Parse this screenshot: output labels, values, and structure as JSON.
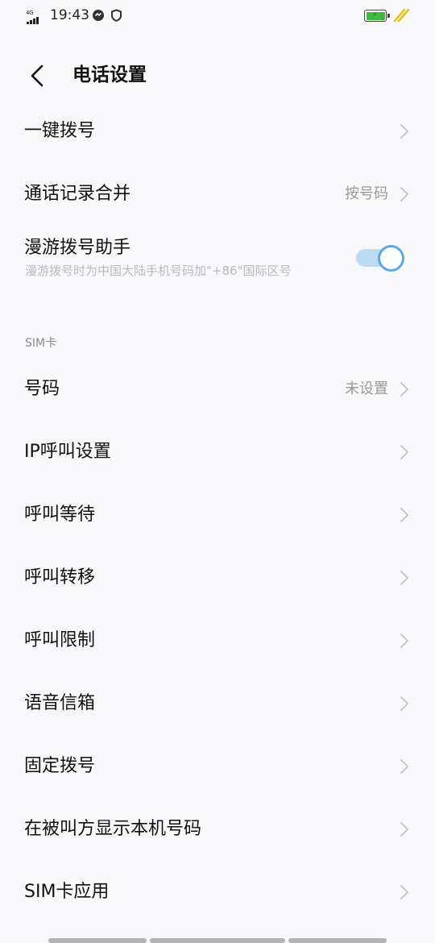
{
  "status_bar": {
    "network": "4G",
    "time": "19:43",
    "icons": [
      "signal-icon",
      "notification-app-icon",
      "shield-icon",
      "battery-icon",
      "charging-icon"
    ],
    "battery_color": "#3dbb3f"
  },
  "header": {
    "back_icon": "chevron-left-icon",
    "title": "电话设置"
  },
  "settings": {
    "one_touch_dial": {
      "label": "一键拨号"
    },
    "merge_call_log": {
      "label": "通话记录合并",
      "value": "按号码"
    },
    "roaming_assistant": {
      "label": "漫游拨号助手",
      "description": "漫游拨号时为中国大陆手机号码加\"+86\"国际区号",
      "enabled": true
    }
  },
  "sim_section": {
    "title": "SIM卡",
    "number": {
      "label": "号码",
      "value": "未设置"
    },
    "ip_call": {
      "label": "IP呼叫设置"
    },
    "call_waiting": {
      "label": "呼叫等待"
    },
    "call_forwarding": {
      "label": "呼叫转移"
    },
    "call_barring": {
      "label": "呼叫限制"
    },
    "voicemail": {
      "label": "语音信箱"
    },
    "fixed_dialing": {
      "label": "固定拨号"
    },
    "show_my_number": {
      "label": "在被叫方显示本机号码"
    },
    "sim_apps": {
      "label": "SIM卡应用"
    }
  },
  "colors": {
    "background": "#f8f8fb",
    "toggle_accent": "#5aa8ea",
    "secondary_text": "#9a9a9a"
  }
}
